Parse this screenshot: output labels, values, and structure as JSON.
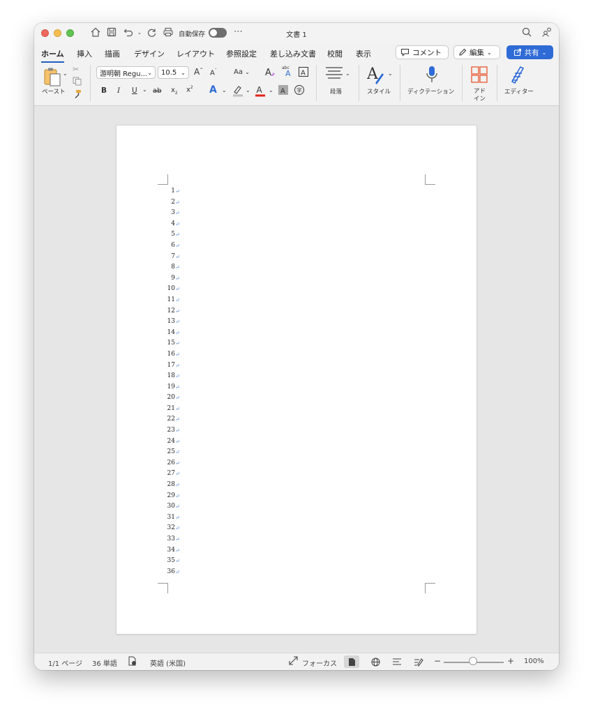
{
  "window": {
    "title": "文書 1",
    "autosave_label": "自動保存"
  },
  "tabs": [
    "ホーム",
    "挿入",
    "描画",
    "デザイン",
    "レイアウト",
    "参照設定",
    "差し込み文書",
    "校閲",
    "表示"
  ],
  "header_buttons": {
    "comment": "コメント",
    "edit": "編集",
    "share": "共有"
  },
  "ribbon": {
    "paste_label": "ペースト",
    "font_name": "游明朝 Regu...",
    "font_size": "10.5",
    "paragraph_label": "段落",
    "styles_label": "スタイル",
    "dictation_label": "ディクテーション",
    "addins_label_1": "アド",
    "addins_label_2": "イン",
    "editor_label": "エディター",
    "bold": "B",
    "italic": "I",
    "underline": "U",
    "strike": "ab",
    "subscript": "x",
    "superscript": "x",
    "aa_label": "Aa"
  },
  "document": {
    "line_numbers": [
      "1",
      "2",
      "3",
      "4",
      "5",
      "6",
      "7",
      "8",
      "9",
      "10",
      "11",
      "12",
      "13",
      "14",
      "15",
      "16",
      "17",
      "18",
      "19",
      "20",
      "21",
      "22",
      "23",
      "24",
      "25",
      "26",
      "27",
      "28",
      "29",
      "30",
      "31",
      "32",
      "33",
      "34",
      "35",
      "36"
    ],
    "paragraph_mark": "↵"
  },
  "status": {
    "page": "1/1 ページ",
    "words": "36 単語",
    "language": "英語 (米国)",
    "focus": "フォーカス",
    "zoom": "100%",
    "zoom_minus": "−",
    "zoom_plus": "+"
  },
  "colors": {
    "accent": "#1f5fbf",
    "share_bg": "#2f6bd6",
    "font_color_bar": "#e2231a",
    "highlight_bar": "#bfbfbf",
    "line_mark": "#5b8bd6"
  }
}
